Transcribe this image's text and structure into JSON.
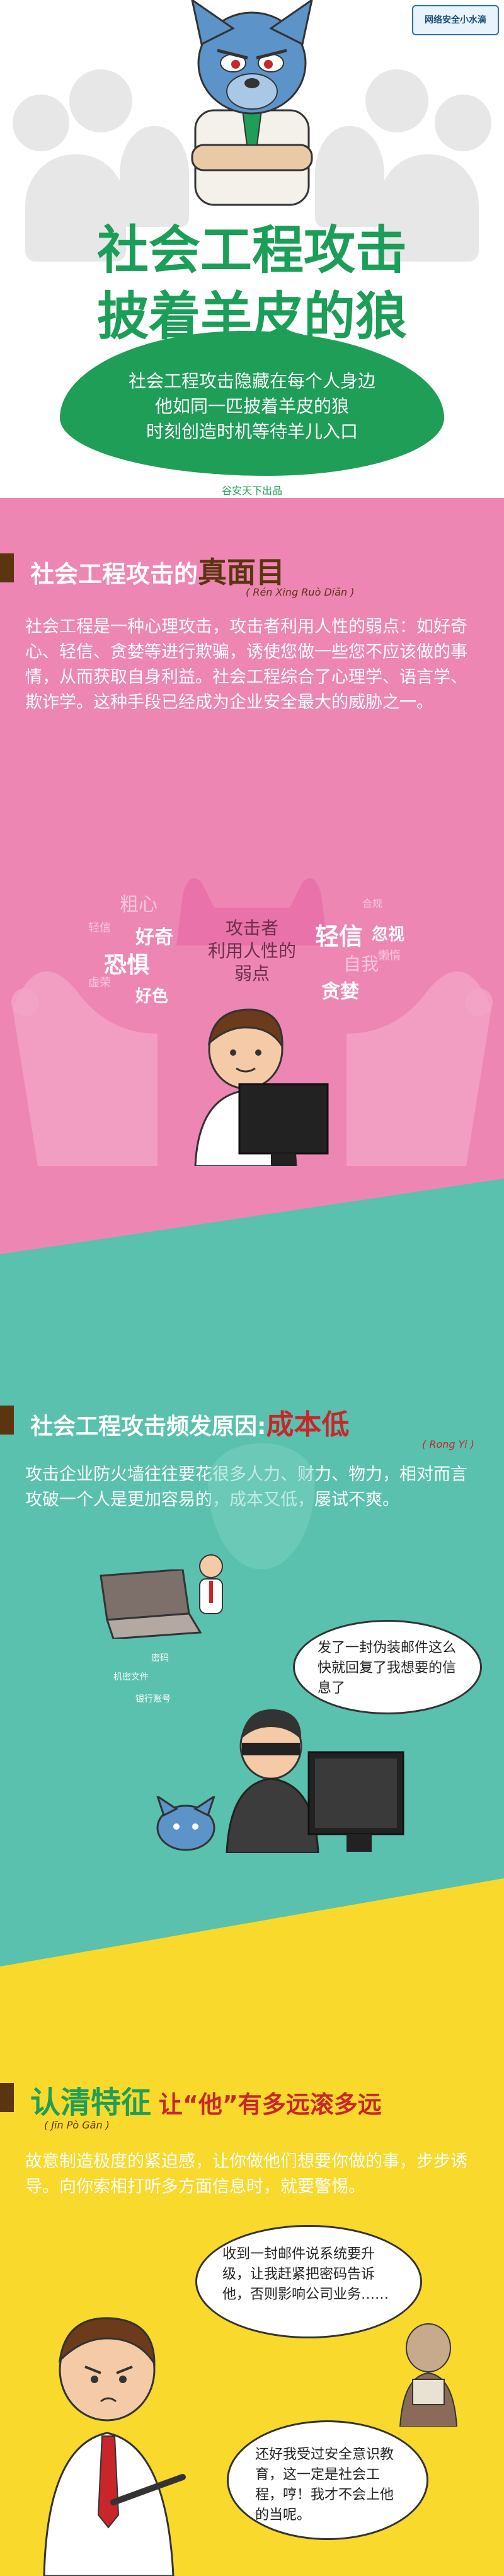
{
  "header": {
    "badge": "网络安全小水滴",
    "title_line1": "社会工程攻击",
    "title_line2": "披着羊皮的狼",
    "intro_lines": [
      "社会工程攻击隐藏在每个人身边",
      "他如同一匹披着羊皮的狼",
      "时刻创造时机等待羊儿入口"
    ],
    "credit": "谷安天下出品"
  },
  "section_truth": {
    "heading_prefix": "社会工程攻击的",
    "heading_highlight": "真面目",
    "pinyin": "( Rén Xing Ruò Diǎn )",
    "paragraph": "社会工程是一种心理攻击，攻击者利用人性的弱点：如好奇心、轻信、贪婪等进行欺骗，诱使您做一些您不应该做的事情，从而获取自身利益。社会工程综合了心理学、语言学、欺诈学。这种手段已经成为企业安全最大的威胁之一。",
    "center_label": "攻击者\n利用人性的\n弱点",
    "left_words": [
      "粗心",
      "好奇",
      "恐惧",
      "好色",
      "轻信",
      "虚荣"
    ],
    "right_words": [
      "轻信",
      "忽视",
      "自我",
      "贪婪",
      "懒惰",
      "合规"
    ]
  },
  "section_cost": {
    "heading_prefix": "社会工程攻击频发原因:",
    "heading_highlight": "成本低",
    "pinyin": "( Rong Yi )",
    "paragraph": "攻击企业防火墙往往要花很多人力、财力、物力，相对而言攻破一个人是更加容易的，成本又低，屡试不爽。",
    "labels": [
      "密码",
      "机密文件",
      "银行账号"
    ],
    "bubble": "发了一封伪装邮件这么快就回复了我想要的信息了"
  },
  "section_identify": {
    "heading_highlight": "认清特征",
    "heading_suffix": "让“他”有多远滚多远",
    "pinyin": "( Jīn Pò Gān )",
    "paragraph": "故意制造极度的紧迫感，让你做他们想要你做的事，步步诱导。向你索相打听多方面信息时，就要警惕。",
    "bubble_top": "收到一封邮件说系统要升级，让我赶紧把密码告诉他，否则影响公司业务……",
    "bubble_bottom": "还好我受过安全意识教育，这一定是社会工程，哼！我才不会上他的当呢。"
  },
  "colors": {
    "green": "#1f9e58",
    "pink": "#ee86b4",
    "teal": "#59c1ad",
    "yellow": "#f8d92c",
    "red_highlight": "#c8262b",
    "dark_brown": "#5b3410"
  }
}
